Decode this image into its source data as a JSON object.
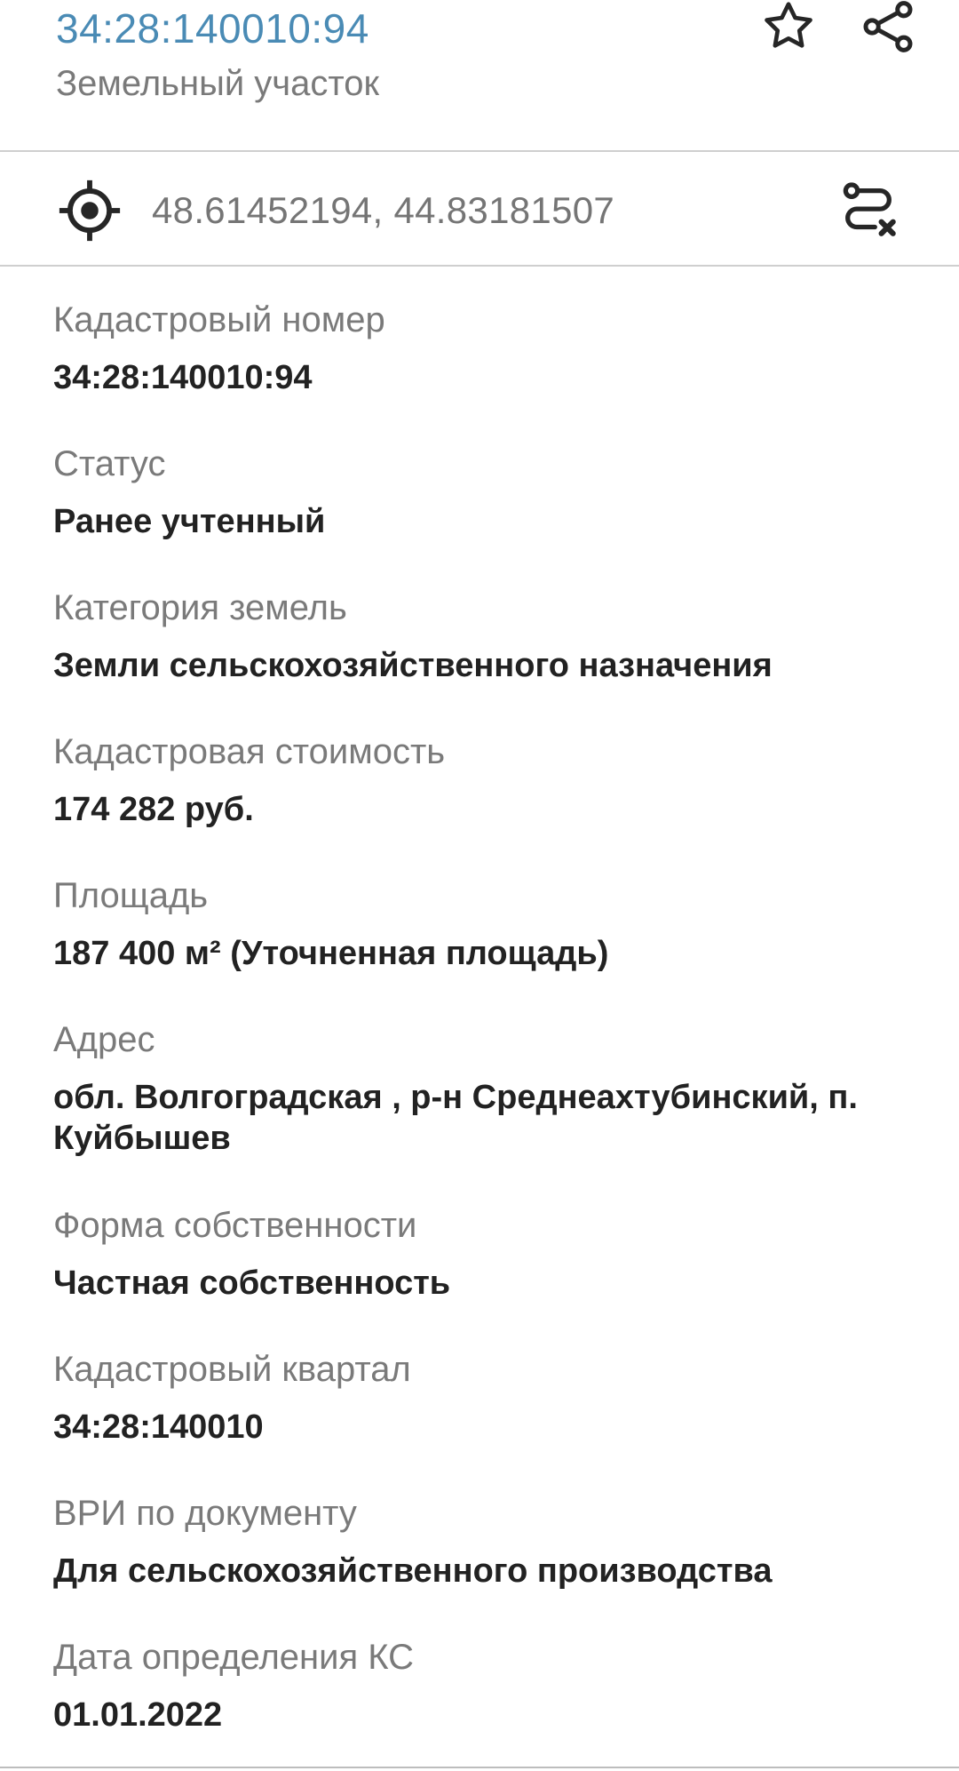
{
  "header": {
    "title": "34:28:140010:94",
    "subtitle": "Земельный участок",
    "favorite_icon": "star-icon",
    "share_icon": "share-icon"
  },
  "location": {
    "icon": "locate-icon",
    "coordinates": "48.61452194, 44.83181507",
    "route_icon": "route-clear-icon"
  },
  "properties": [
    {
      "label": "Кадастровый номер",
      "value": "34:28:140010:94"
    },
    {
      "label": "Статус",
      "value": "Ранее учтенный"
    },
    {
      "label": "Категория земель",
      "value": "Земли сельскохозяйственного назначения"
    },
    {
      "label": "Кадастровая стоимость",
      "value": "174 282 руб."
    },
    {
      "label": "Площадь",
      "value": "187 400 м² (Уточненная площадь)"
    },
    {
      "label": "Адрес",
      "value": "обл. Волгоградская , р-н Среднеахтубинский, п. Куйбышев"
    },
    {
      "label": "Форма собственности",
      "value": "Частная собственность"
    },
    {
      "label": "Кадастровый квартал",
      "value": "34:28:140010"
    },
    {
      "label": "ВРИ по документу",
      "value": "Для сельскохозяйственного производства"
    },
    {
      "label": "Дата определения КС",
      "value": "01.01.2022"
    }
  ],
  "colors": {
    "accent": "#4a8bb5",
    "label": "#7a7a7a",
    "value": "#222222",
    "divider": "#cfcfcf"
  }
}
